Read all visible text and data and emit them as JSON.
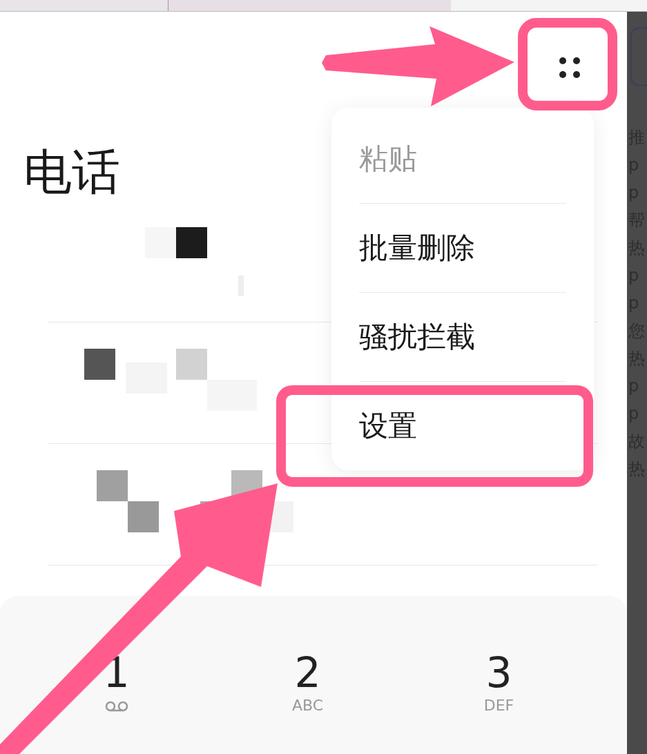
{
  "title": "电话",
  "menu": {
    "items": [
      {
        "label": "粘贴",
        "disabled": true,
        "highlighted": false
      },
      {
        "label": "批量删除",
        "disabled": false,
        "highlighted": false
      },
      {
        "label": "骚扰拦截",
        "disabled": false,
        "highlighted": false
      },
      {
        "label": "设置",
        "disabled": false,
        "highlighted": true
      }
    ]
  },
  "keypad": [
    {
      "digit": "1",
      "kind": "voicemail"
    },
    {
      "digit": "2",
      "kind": "letters",
      "letters": "ABC"
    },
    {
      "digit": "3",
      "kind": "letters",
      "letters": "DEF"
    }
  ],
  "side_panel": {
    "texts": [
      "推",
      "p",
      "p",
      "帮",
      "热",
      "p",
      "p",
      "您",
      "热",
      "p",
      "p",
      "故",
      "热"
    ]
  }
}
